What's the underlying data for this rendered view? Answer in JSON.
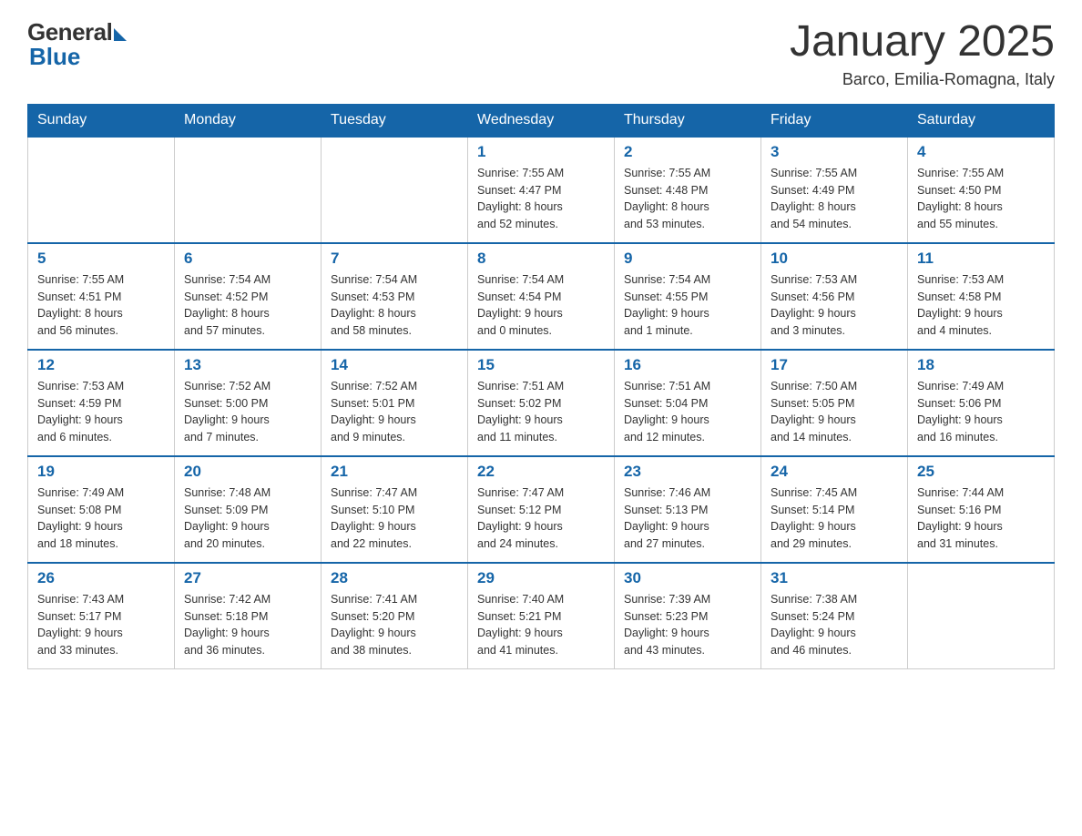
{
  "header": {
    "logo_general": "General",
    "logo_blue": "Blue",
    "month_year": "January 2025",
    "location": "Barco, Emilia-Romagna, Italy"
  },
  "days_of_week": [
    "Sunday",
    "Monday",
    "Tuesday",
    "Wednesday",
    "Thursday",
    "Friday",
    "Saturday"
  ],
  "weeks": [
    [
      {
        "day": "",
        "info": ""
      },
      {
        "day": "",
        "info": ""
      },
      {
        "day": "",
        "info": ""
      },
      {
        "day": "1",
        "info": "Sunrise: 7:55 AM\nSunset: 4:47 PM\nDaylight: 8 hours\nand 52 minutes."
      },
      {
        "day": "2",
        "info": "Sunrise: 7:55 AM\nSunset: 4:48 PM\nDaylight: 8 hours\nand 53 minutes."
      },
      {
        "day": "3",
        "info": "Sunrise: 7:55 AM\nSunset: 4:49 PM\nDaylight: 8 hours\nand 54 minutes."
      },
      {
        "day": "4",
        "info": "Sunrise: 7:55 AM\nSunset: 4:50 PM\nDaylight: 8 hours\nand 55 minutes."
      }
    ],
    [
      {
        "day": "5",
        "info": "Sunrise: 7:55 AM\nSunset: 4:51 PM\nDaylight: 8 hours\nand 56 minutes."
      },
      {
        "day": "6",
        "info": "Sunrise: 7:54 AM\nSunset: 4:52 PM\nDaylight: 8 hours\nand 57 minutes."
      },
      {
        "day": "7",
        "info": "Sunrise: 7:54 AM\nSunset: 4:53 PM\nDaylight: 8 hours\nand 58 minutes."
      },
      {
        "day": "8",
        "info": "Sunrise: 7:54 AM\nSunset: 4:54 PM\nDaylight: 9 hours\nand 0 minutes."
      },
      {
        "day": "9",
        "info": "Sunrise: 7:54 AM\nSunset: 4:55 PM\nDaylight: 9 hours\nand 1 minute."
      },
      {
        "day": "10",
        "info": "Sunrise: 7:53 AM\nSunset: 4:56 PM\nDaylight: 9 hours\nand 3 minutes."
      },
      {
        "day": "11",
        "info": "Sunrise: 7:53 AM\nSunset: 4:58 PM\nDaylight: 9 hours\nand 4 minutes."
      }
    ],
    [
      {
        "day": "12",
        "info": "Sunrise: 7:53 AM\nSunset: 4:59 PM\nDaylight: 9 hours\nand 6 minutes."
      },
      {
        "day": "13",
        "info": "Sunrise: 7:52 AM\nSunset: 5:00 PM\nDaylight: 9 hours\nand 7 minutes."
      },
      {
        "day": "14",
        "info": "Sunrise: 7:52 AM\nSunset: 5:01 PM\nDaylight: 9 hours\nand 9 minutes."
      },
      {
        "day": "15",
        "info": "Sunrise: 7:51 AM\nSunset: 5:02 PM\nDaylight: 9 hours\nand 11 minutes."
      },
      {
        "day": "16",
        "info": "Sunrise: 7:51 AM\nSunset: 5:04 PM\nDaylight: 9 hours\nand 12 minutes."
      },
      {
        "day": "17",
        "info": "Sunrise: 7:50 AM\nSunset: 5:05 PM\nDaylight: 9 hours\nand 14 minutes."
      },
      {
        "day": "18",
        "info": "Sunrise: 7:49 AM\nSunset: 5:06 PM\nDaylight: 9 hours\nand 16 minutes."
      }
    ],
    [
      {
        "day": "19",
        "info": "Sunrise: 7:49 AM\nSunset: 5:08 PM\nDaylight: 9 hours\nand 18 minutes."
      },
      {
        "day": "20",
        "info": "Sunrise: 7:48 AM\nSunset: 5:09 PM\nDaylight: 9 hours\nand 20 minutes."
      },
      {
        "day": "21",
        "info": "Sunrise: 7:47 AM\nSunset: 5:10 PM\nDaylight: 9 hours\nand 22 minutes."
      },
      {
        "day": "22",
        "info": "Sunrise: 7:47 AM\nSunset: 5:12 PM\nDaylight: 9 hours\nand 24 minutes."
      },
      {
        "day": "23",
        "info": "Sunrise: 7:46 AM\nSunset: 5:13 PM\nDaylight: 9 hours\nand 27 minutes."
      },
      {
        "day": "24",
        "info": "Sunrise: 7:45 AM\nSunset: 5:14 PM\nDaylight: 9 hours\nand 29 minutes."
      },
      {
        "day": "25",
        "info": "Sunrise: 7:44 AM\nSunset: 5:16 PM\nDaylight: 9 hours\nand 31 minutes."
      }
    ],
    [
      {
        "day": "26",
        "info": "Sunrise: 7:43 AM\nSunset: 5:17 PM\nDaylight: 9 hours\nand 33 minutes."
      },
      {
        "day": "27",
        "info": "Sunrise: 7:42 AM\nSunset: 5:18 PM\nDaylight: 9 hours\nand 36 minutes."
      },
      {
        "day": "28",
        "info": "Sunrise: 7:41 AM\nSunset: 5:20 PM\nDaylight: 9 hours\nand 38 minutes."
      },
      {
        "day": "29",
        "info": "Sunrise: 7:40 AM\nSunset: 5:21 PM\nDaylight: 9 hours\nand 41 minutes."
      },
      {
        "day": "30",
        "info": "Sunrise: 7:39 AM\nSunset: 5:23 PM\nDaylight: 9 hours\nand 43 minutes."
      },
      {
        "day": "31",
        "info": "Sunrise: 7:38 AM\nSunset: 5:24 PM\nDaylight: 9 hours\nand 46 minutes."
      },
      {
        "day": "",
        "info": ""
      }
    ]
  ]
}
